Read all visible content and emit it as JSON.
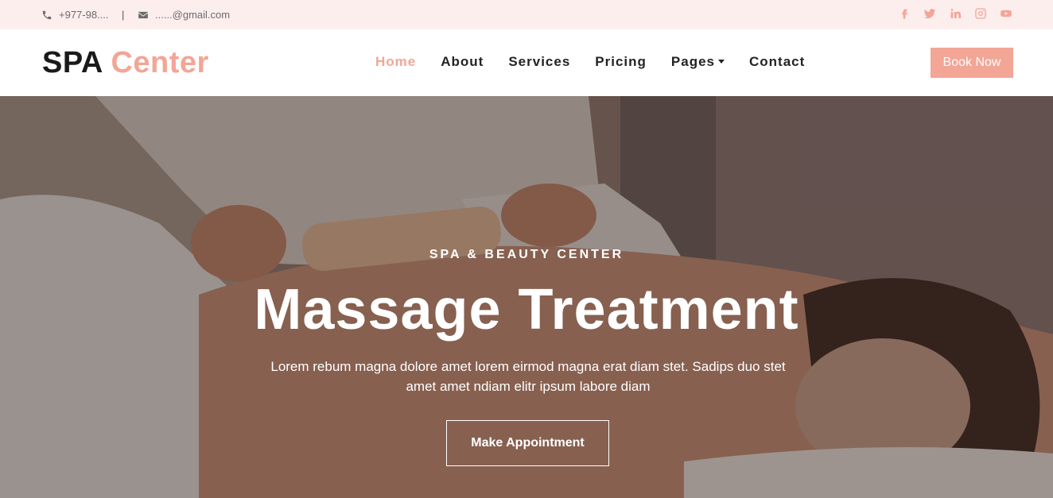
{
  "topbar": {
    "phone": "+977-98....",
    "separator": "|",
    "email": "......@gmail.com",
    "phone_icon": "phone-icon",
    "email_icon": "envelope-icon",
    "socials": [
      "facebook-icon",
      "twitter-icon",
      "linkedin-icon",
      "instagram-icon",
      "youtube-icon"
    ]
  },
  "brand": {
    "part1": "SPA",
    "part2": "Center"
  },
  "nav": {
    "items": [
      "Home",
      "About",
      "Services",
      "Pricing",
      "Pages",
      "Contact"
    ],
    "active": "Home"
  },
  "book_button": "Book Now",
  "hero": {
    "subtitle": "SPA & BEAUTY CENTER",
    "title": "Massage Treatment",
    "text": "Lorem rebum magna dolore amet lorem eirmod magna erat diam stet. Sadips duo stet amet amet ndiam elitr ipsum labore diam",
    "button": "Make Appointment"
  },
  "colors": {
    "accent": "#f3a596",
    "topbar_bg": "#fdeeee",
    "dark": "#1a1a1a"
  }
}
